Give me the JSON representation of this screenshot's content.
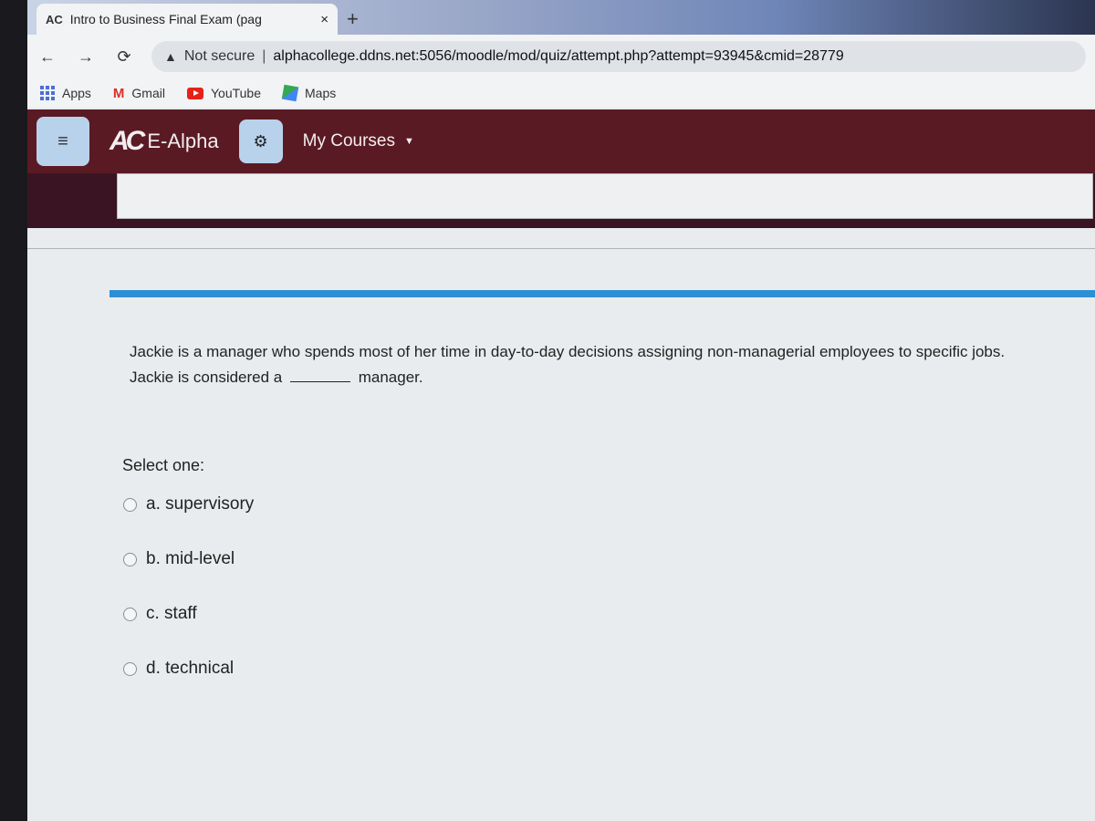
{
  "browser": {
    "tab": {
      "favicon": "AC",
      "title": "Intro to Business Final Exam (pag",
      "close": "×"
    },
    "new_tab": "+",
    "nav": {
      "back": "←",
      "forward": "→",
      "reload": "⟳"
    },
    "omnibox": {
      "security_label": "Not secure",
      "separator": "|",
      "url": "alphacollege.ddns.net:5056/moodle/mod/quiz/attempt.php?attempt=93945&cmid=28779"
    },
    "bookmarks": [
      {
        "label": "Apps",
        "icon": "apps-icon"
      },
      {
        "label": "Gmail",
        "icon": "gmail-icon"
      },
      {
        "label": "YouTube",
        "icon": "youtube-icon"
      },
      {
        "label": "Maps",
        "icon": "maps-icon"
      }
    ]
  },
  "site": {
    "menu_icon": "≡",
    "logo_mark": "AC",
    "brand": "E-Alpha",
    "gear_icon": "⚙",
    "my_courses": "My Courses",
    "caret": "▼",
    "header_color": "#5a1a24",
    "accent_color": "#2d8fd5"
  },
  "question": {
    "text_before": "Jackie is a manager who spends most of her time in day-to-day decisions assigning non-managerial employees to specific jobs. Jackie is considered a",
    "text_after": "manager.",
    "prompt": "Select one:",
    "options": [
      {
        "label": "a. supervisory",
        "selected": false
      },
      {
        "label": "b. mid-level",
        "selected": false
      },
      {
        "label": "c. staff",
        "selected": false
      },
      {
        "label": "d. technical",
        "selected": false
      }
    ]
  }
}
